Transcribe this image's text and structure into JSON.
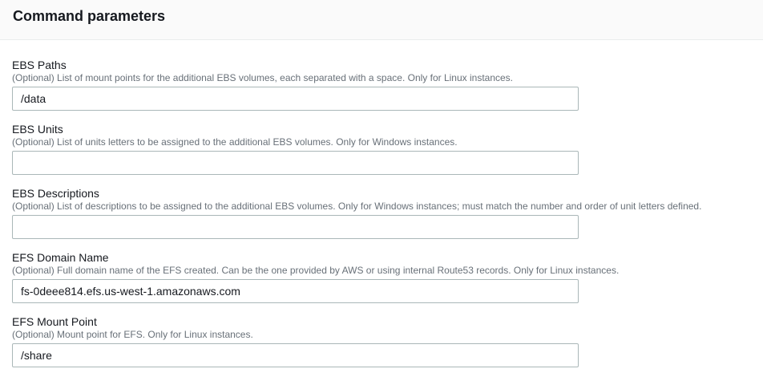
{
  "header": {
    "title": "Command parameters"
  },
  "fields": [
    {
      "label": "EBS Paths",
      "description": "(Optional) List of mount points for the additional EBS volumes, each separated with a space. Only for Linux instances.",
      "value": "/data"
    },
    {
      "label": "EBS Units",
      "description": "(Optional) List of units letters to be assigned to the additional EBS volumes. Only for Windows instances.",
      "value": ""
    },
    {
      "label": "EBS Descriptions",
      "description": "(Optional) List of descriptions to be assigned to the additional EBS volumes. Only for Windows instances; must match the number and order of unit letters defined.",
      "value": ""
    },
    {
      "label": "EFS Domain Name",
      "description": "(Optional) Full domain name of the EFS created. Can be the one provided by AWS or using internal Route53 records. Only for Linux instances.",
      "value": "fs-0deee814.efs.us-west-1.amazonaws.com"
    },
    {
      "label": "EFS Mount Point",
      "description": "(Optional) Mount point for EFS. Only for Linux instances.",
      "value": "/share"
    }
  ]
}
